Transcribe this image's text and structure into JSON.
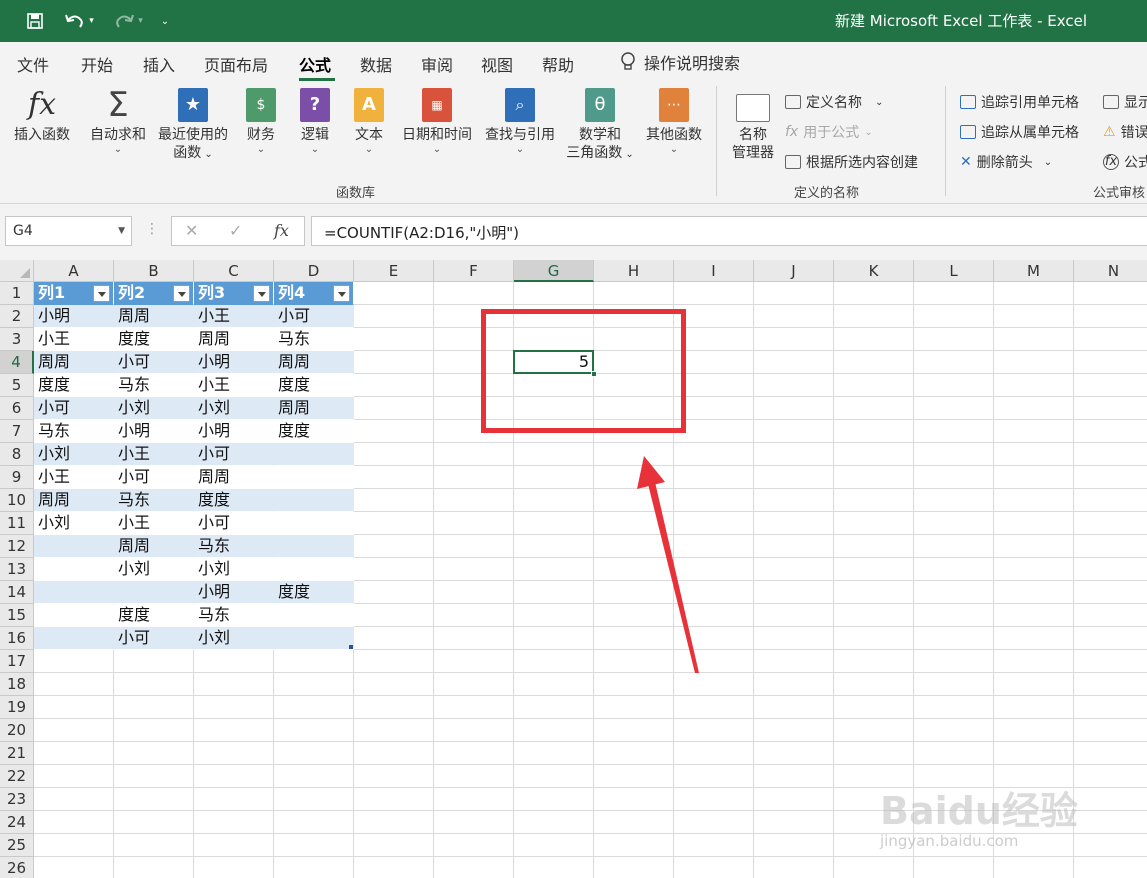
{
  "window": {
    "title": "新建 Microsoft Excel 工作表  -  Excel"
  },
  "qat": {
    "save": "save-icon",
    "undo": "undo-icon",
    "redo": "redo-icon",
    "customize": "customize-icon"
  },
  "menu": {
    "tabs": [
      "文件",
      "开始",
      "插入",
      "页面布局",
      "公式",
      "数据",
      "审阅",
      "视图",
      "帮助"
    ],
    "active": "公式",
    "tell_me": "操作说明搜索"
  },
  "ribbon": {
    "function_library": {
      "label": "函数库",
      "insert_function": "插入函数",
      "autosum": "自动求和",
      "recent_1": "最近使用的",
      "recent_2": "函数",
      "financial": "财务",
      "logical": "逻辑",
      "text": "文本",
      "datetime": "日期和时间",
      "lookup": "查找与引用",
      "math_1": "数学和",
      "math_2": "三角函数",
      "more": "其他函数"
    },
    "defined_names": {
      "label": "定义的名称",
      "name_manager_1": "名称",
      "name_manager_2": "管理器",
      "define_name": "定义名称",
      "use_in_formula": "用于公式",
      "create_from_selection": "根据所选内容创建"
    },
    "formula_auditing": {
      "label": "公式审核",
      "trace_precedents": "追踪引用单元格",
      "trace_dependents": "追踪从属单元格",
      "remove_arrows": "删除箭头",
      "show_formulas": "显示",
      "error_checking": "错误",
      "evaluate": "公式"
    }
  },
  "formula_bar": {
    "name_box": "G4",
    "cancel": "✕",
    "enter": "✓",
    "fx": "fx",
    "formula": "=COUNTIF(A2:D16,\"小明\")"
  },
  "sheet": {
    "columns": [
      "A",
      "B",
      "C",
      "D",
      "E",
      "F",
      "G",
      "H",
      "I",
      "J",
      "K",
      "L",
      "M",
      "N"
    ],
    "rows": [
      "1",
      "2",
      "3",
      "4",
      "5",
      "6",
      "7",
      "8",
      "9",
      "10",
      "11",
      "12",
      "13",
      "14",
      "15",
      "16",
      "17",
      "18",
      "19",
      "20",
      "21",
      "22",
      "23",
      "24",
      "25",
      "26"
    ],
    "table_headers": [
      "列1",
      "列2",
      "列3",
      "列4"
    ],
    "table_rows": [
      [
        "小明",
        "周周",
        "小王",
        "小可"
      ],
      [
        "小王",
        "度度",
        "周周",
        "马东"
      ],
      [
        "周周",
        "小可",
        "小明",
        "周周"
      ],
      [
        "度度",
        "马东",
        "小王",
        "度度"
      ],
      [
        "小可",
        "小刘",
        "小刘",
        "周周"
      ],
      [
        "马东",
        "小明",
        "小明",
        "度度"
      ],
      [
        "小刘",
        "小王",
        "小可",
        ""
      ],
      [
        "小王",
        "小可",
        "周周",
        ""
      ],
      [
        "周周",
        "马东",
        "度度",
        ""
      ],
      [
        "小刘",
        "小王",
        "小可",
        ""
      ],
      [
        "",
        "周周",
        "马东",
        ""
      ],
      [
        "",
        "小刘",
        "小刘",
        ""
      ],
      [
        "",
        "",
        "小明",
        "度度"
      ],
      [
        "",
        "度度",
        "马东",
        ""
      ],
      [
        "",
        "小可",
        "小刘",
        ""
      ]
    ],
    "active_cell": {
      "ref": "G4",
      "value": "5"
    }
  },
  "watermark": {
    "logo": "Baidu经验",
    "url": "jingyan.baidu.com"
  },
  "colors": {
    "excel_green": "#217346",
    "table_header": "#5b9bd5",
    "table_band": "#dde9f5",
    "highlight": "#e8323a"
  }
}
